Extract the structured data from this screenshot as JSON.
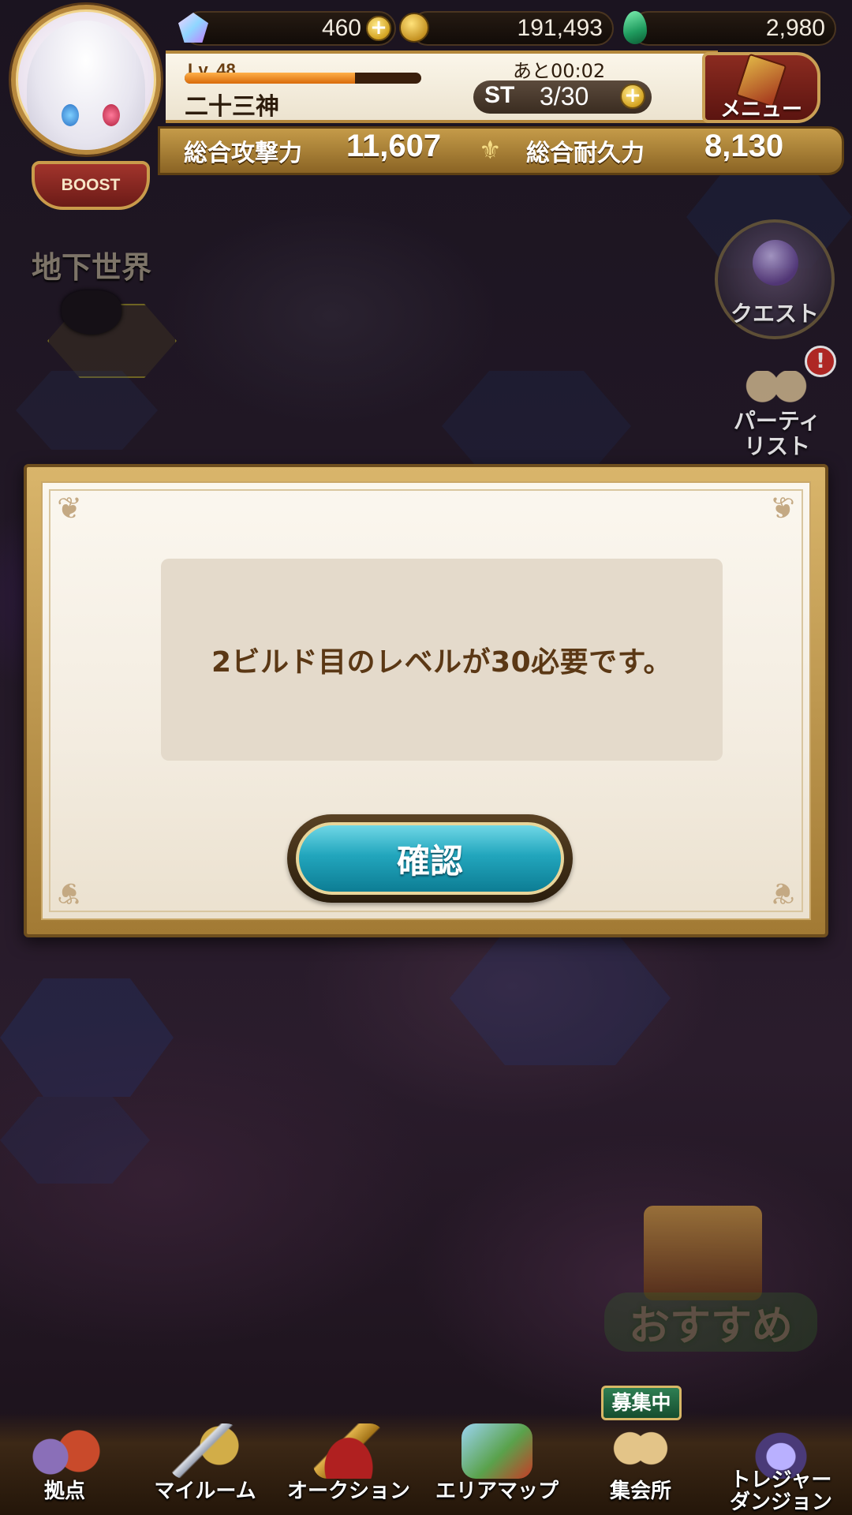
{
  "header": {
    "currencies": [
      {
        "icon": "gem-icon",
        "value": "460"
      },
      {
        "icon": "gold-coin-icon",
        "value": "191,493"
      },
      {
        "icon": "emerald-icon",
        "value": "2,980"
      }
    ],
    "player": {
      "level": "Lv. 48",
      "level_progress": 0.72,
      "name": "二十三神",
      "boost_label": "BOOST"
    },
    "stamina": {
      "timer": "あと00:02",
      "label": "ST",
      "value": "3/30"
    },
    "menu_label": "メニュー",
    "power": {
      "attack_label": "総合攻撃力",
      "attack_value": "11,607",
      "defense_label": "総合耐久力",
      "defense_value": "8,130"
    }
  },
  "map": {
    "area_label": "地下世界"
  },
  "side_buttons": {
    "quest_label": "クエスト",
    "party_label_1": "パーティ",
    "party_label_2": "リスト",
    "recommend_label": "おすすめ",
    "alert_mark": "!"
  },
  "dialog": {
    "message": "2ビルド目のレベルが30必要です。",
    "confirm_label": "確認"
  },
  "bottom_nav": {
    "items": [
      {
        "label": "拠点"
      },
      {
        "label": "マイルーム"
      },
      {
        "label": "オークション"
      },
      {
        "label": "エリアマップ"
      },
      {
        "label": "集会所",
        "badge": "募集中"
      },
      {
        "label_1": "トレジャー",
        "label_2": "ダンジョン"
      }
    ]
  },
  "colors": {
    "accent_gold": "#c59b49",
    "confirm_teal": "#22a6bd",
    "message_text": "#5b3815"
  }
}
